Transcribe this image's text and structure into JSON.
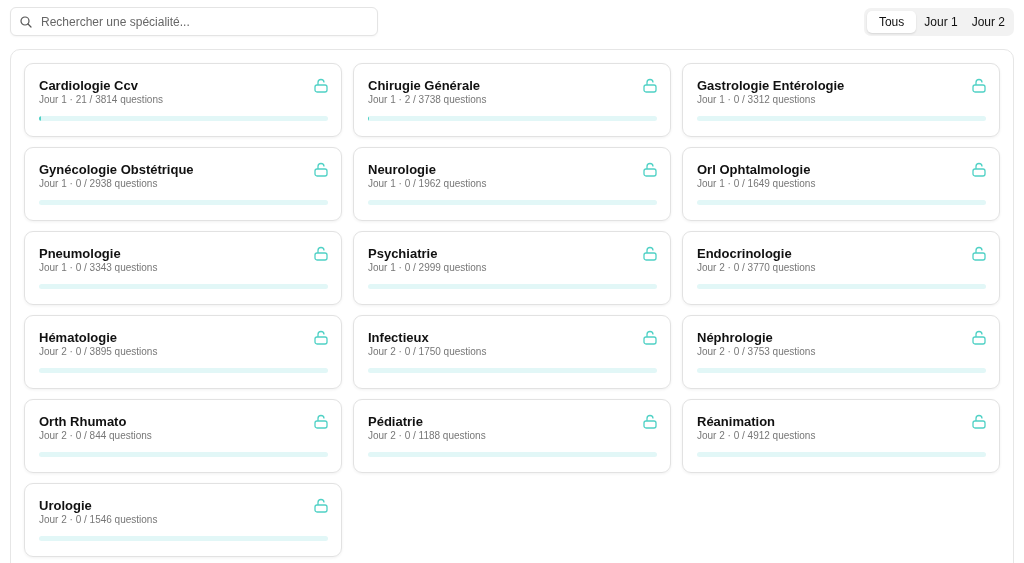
{
  "search": {
    "placeholder": "Rechercher une spécialité..."
  },
  "filters": [
    {
      "label": "Tous",
      "selected": true
    },
    {
      "label": "Jour 1",
      "selected": false
    },
    {
      "label": "Jour 2",
      "selected": false
    }
  ],
  "specialties": [
    {
      "name": "Cardiologie Ccv",
      "meta": "Jour 1 · 21 / 3814 questions",
      "level": 0.0055,
      "locked": false
    },
    {
      "name": "Chirugie Générale",
      "meta": "Jour 1 · 2 / 3738 questions",
      "level": 0.0005,
      "locked": false
    },
    {
      "name": "Gastrologie Entérologie",
      "meta": "Jour 1 · 0 / 3312 questions",
      "level": 0,
      "locked": false
    },
    {
      "name": "Gynécologie Obstétrique",
      "meta": "Jour 1 · 0 / 2938 questions",
      "level": 0,
      "locked": false
    },
    {
      "name": "Neurologie",
      "meta": "Jour 1 · 0 / 1962 questions",
      "level": 0,
      "locked": false
    },
    {
      "name": "Orl Ophtalmologie",
      "meta": "Jour 1 · 0 / 1649 questions",
      "level": 0,
      "locked": false
    },
    {
      "name": "Pneumologie",
      "meta": "Jour 1 · 0 / 3343 questions",
      "level": 0,
      "locked": false
    },
    {
      "name": "Psychiatrie",
      "meta": "Jour 1 · 0 / 2999 questions",
      "level": 0,
      "locked": false
    },
    {
      "name": "Endocrinologie",
      "meta": "Jour 2 · 0 / 3770 questions",
      "level": 0,
      "locked": false
    },
    {
      "name": "Hématologie",
      "meta": "Jour 2 · 0 / 3895 questions",
      "level": 0,
      "locked": false
    },
    {
      "name": "Infectieux",
      "meta": "Jour 2 · 0 / 1750 questions",
      "level": 0,
      "locked": false
    },
    {
      "name": "Néphrologie",
      "meta": "Jour 2 · 0 / 3753 questions",
      "level": 0,
      "locked": false
    },
    {
      "name": "Orth Rhumato",
      "meta": "Jour 2 · 0 / 844 questions",
      "level": 0,
      "locked": false
    },
    {
      "name": "Pédiatrie",
      "meta": "Jour 2 · 0 / 1188 questions",
      "level": 0,
      "locked": false
    },
    {
      "name": "Réanimation",
      "meta": "Jour 2 · 0 / 4912 questions",
      "level": 0,
      "locked": false
    },
    {
      "name": "Urologie",
      "meta": "Jour 2 · 0 / 1546 questions",
      "level": 0,
      "locked": false
    }
  ]
}
